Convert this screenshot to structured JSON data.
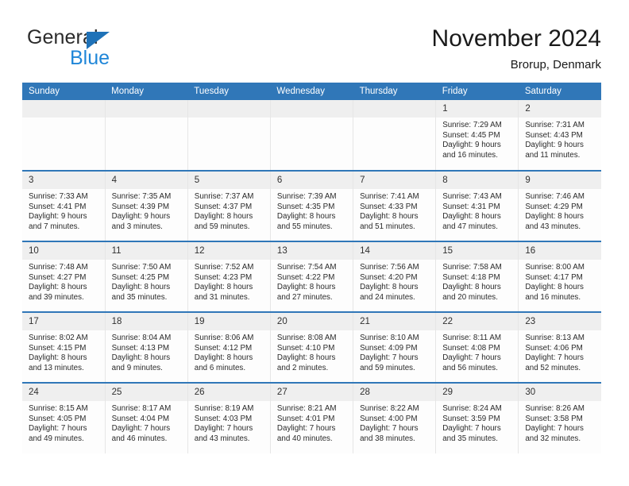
{
  "brand": {
    "name_part1": "General",
    "name_part2": "Blue",
    "logo_icon": "triangle-icon"
  },
  "header": {
    "title": "November 2024",
    "location": "Brorup, Denmark"
  },
  "colors": {
    "header_blue": "#3077b8",
    "brand_blue": "#1f86d8",
    "logo_triangle_blue": "#1f72b8",
    "daynum_band": "#efefef",
    "cell_background": "#fdfdfd",
    "divider": "#e6e6e6"
  },
  "weekday_headers": [
    "Sunday",
    "Monday",
    "Tuesday",
    "Wednesday",
    "Thursday",
    "Friday",
    "Saturday"
  ],
  "labels": {
    "sunrise_prefix": "Sunrise:",
    "sunset_prefix": "Sunset:",
    "daylight_prefix": "Daylight:"
  },
  "weeks": [
    [
      {
        "day": "",
        "sunrise": "",
        "sunset": "",
        "daylight_line1": "",
        "daylight_line2": "",
        "empty": true
      },
      {
        "day": "",
        "sunrise": "",
        "sunset": "",
        "daylight_line1": "",
        "daylight_line2": "",
        "empty": true
      },
      {
        "day": "",
        "sunrise": "",
        "sunset": "",
        "daylight_line1": "",
        "daylight_line2": "",
        "empty": true
      },
      {
        "day": "",
        "sunrise": "",
        "sunset": "",
        "daylight_line1": "",
        "daylight_line2": "",
        "empty": true
      },
      {
        "day": "",
        "sunrise": "",
        "sunset": "",
        "daylight_line1": "",
        "daylight_line2": "",
        "empty": true
      },
      {
        "day": "1",
        "sunrise": "Sunrise: 7:29 AM",
        "sunset": "Sunset: 4:45 PM",
        "daylight_line1": "Daylight: 9 hours",
        "daylight_line2": "and 16 minutes."
      },
      {
        "day": "2",
        "sunrise": "Sunrise: 7:31 AM",
        "sunset": "Sunset: 4:43 PM",
        "daylight_line1": "Daylight: 9 hours",
        "daylight_line2": "and 11 minutes."
      }
    ],
    [
      {
        "day": "3",
        "sunrise": "Sunrise: 7:33 AM",
        "sunset": "Sunset: 4:41 PM",
        "daylight_line1": "Daylight: 9 hours",
        "daylight_line2": "and 7 minutes."
      },
      {
        "day": "4",
        "sunrise": "Sunrise: 7:35 AM",
        "sunset": "Sunset: 4:39 PM",
        "daylight_line1": "Daylight: 9 hours",
        "daylight_line2": "and 3 minutes."
      },
      {
        "day": "5",
        "sunrise": "Sunrise: 7:37 AM",
        "sunset": "Sunset: 4:37 PM",
        "daylight_line1": "Daylight: 8 hours",
        "daylight_line2": "and 59 minutes."
      },
      {
        "day": "6",
        "sunrise": "Sunrise: 7:39 AM",
        "sunset": "Sunset: 4:35 PM",
        "daylight_line1": "Daylight: 8 hours",
        "daylight_line2": "and 55 minutes."
      },
      {
        "day": "7",
        "sunrise": "Sunrise: 7:41 AM",
        "sunset": "Sunset: 4:33 PM",
        "daylight_line1": "Daylight: 8 hours",
        "daylight_line2": "and 51 minutes."
      },
      {
        "day": "8",
        "sunrise": "Sunrise: 7:43 AM",
        "sunset": "Sunset: 4:31 PM",
        "daylight_line1": "Daylight: 8 hours",
        "daylight_line2": "and 47 minutes."
      },
      {
        "day": "9",
        "sunrise": "Sunrise: 7:46 AM",
        "sunset": "Sunset: 4:29 PM",
        "daylight_line1": "Daylight: 8 hours",
        "daylight_line2": "and 43 minutes."
      }
    ],
    [
      {
        "day": "10",
        "sunrise": "Sunrise: 7:48 AM",
        "sunset": "Sunset: 4:27 PM",
        "daylight_line1": "Daylight: 8 hours",
        "daylight_line2": "and 39 minutes."
      },
      {
        "day": "11",
        "sunrise": "Sunrise: 7:50 AM",
        "sunset": "Sunset: 4:25 PM",
        "daylight_line1": "Daylight: 8 hours",
        "daylight_line2": "and 35 minutes."
      },
      {
        "day": "12",
        "sunrise": "Sunrise: 7:52 AM",
        "sunset": "Sunset: 4:23 PM",
        "daylight_line1": "Daylight: 8 hours",
        "daylight_line2": "and 31 minutes."
      },
      {
        "day": "13",
        "sunrise": "Sunrise: 7:54 AM",
        "sunset": "Sunset: 4:22 PM",
        "daylight_line1": "Daylight: 8 hours",
        "daylight_line2": "and 27 minutes."
      },
      {
        "day": "14",
        "sunrise": "Sunrise: 7:56 AM",
        "sunset": "Sunset: 4:20 PM",
        "daylight_line1": "Daylight: 8 hours",
        "daylight_line2": "and 24 minutes."
      },
      {
        "day": "15",
        "sunrise": "Sunrise: 7:58 AM",
        "sunset": "Sunset: 4:18 PM",
        "daylight_line1": "Daylight: 8 hours",
        "daylight_line2": "and 20 minutes."
      },
      {
        "day": "16",
        "sunrise": "Sunrise: 8:00 AM",
        "sunset": "Sunset: 4:17 PM",
        "daylight_line1": "Daylight: 8 hours",
        "daylight_line2": "and 16 minutes."
      }
    ],
    [
      {
        "day": "17",
        "sunrise": "Sunrise: 8:02 AM",
        "sunset": "Sunset: 4:15 PM",
        "daylight_line1": "Daylight: 8 hours",
        "daylight_line2": "and 13 minutes."
      },
      {
        "day": "18",
        "sunrise": "Sunrise: 8:04 AM",
        "sunset": "Sunset: 4:13 PM",
        "daylight_line1": "Daylight: 8 hours",
        "daylight_line2": "and 9 minutes."
      },
      {
        "day": "19",
        "sunrise": "Sunrise: 8:06 AM",
        "sunset": "Sunset: 4:12 PM",
        "daylight_line1": "Daylight: 8 hours",
        "daylight_line2": "and 6 minutes."
      },
      {
        "day": "20",
        "sunrise": "Sunrise: 8:08 AM",
        "sunset": "Sunset: 4:10 PM",
        "daylight_line1": "Daylight: 8 hours",
        "daylight_line2": "and 2 minutes."
      },
      {
        "day": "21",
        "sunrise": "Sunrise: 8:10 AM",
        "sunset": "Sunset: 4:09 PM",
        "daylight_line1": "Daylight: 7 hours",
        "daylight_line2": "and 59 minutes."
      },
      {
        "day": "22",
        "sunrise": "Sunrise: 8:11 AM",
        "sunset": "Sunset: 4:08 PM",
        "daylight_line1": "Daylight: 7 hours",
        "daylight_line2": "and 56 minutes."
      },
      {
        "day": "23",
        "sunrise": "Sunrise: 8:13 AM",
        "sunset": "Sunset: 4:06 PM",
        "daylight_line1": "Daylight: 7 hours",
        "daylight_line2": "and 52 minutes."
      }
    ],
    [
      {
        "day": "24",
        "sunrise": "Sunrise: 8:15 AM",
        "sunset": "Sunset: 4:05 PM",
        "daylight_line1": "Daylight: 7 hours",
        "daylight_line2": "and 49 minutes."
      },
      {
        "day": "25",
        "sunrise": "Sunrise: 8:17 AM",
        "sunset": "Sunset: 4:04 PM",
        "daylight_line1": "Daylight: 7 hours",
        "daylight_line2": "and 46 minutes."
      },
      {
        "day": "26",
        "sunrise": "Sunrise: 8:19 AM",
        "sunset": "Sunset: 4:03 PM",
        "daylight_line1": "Daylight: 7 hours",
        "daylight_line2": "and 43 minutes."
      },
      {
        "day": "27",
        "sunrise": "Sunrise: 8:21 AM",
        "sunset": "Sunset: 4:01 PM",
        "daylight_line1": "Daylight: 7 hours",
        "daylight_line2": "and 40 minutes."
      },
      {
        "day": "28",
        "sunrise": "Sunrise: 8:22 AM",
        "sunset": "Sunset: 4:00 PM",
        "daylight_line1": "Daylight: 7 hours",
        "daylight_line2": "and 38 minutes."
      },
      {
        "day": "29",
        "sunrise": "Sunrise: 8:24 AM",
        "sunset": "Sunset: 3:59 PM",
        "daylight_line1": "Daylight: 7 hours",
        "daylight_line2": "and 35 minutes."
      },
      {
        "day": "30",
        "sunrise": "Sunrise: 8:26 AM",
        "sunset": "Sunset: 3:58 PM",
        "daylight_line1": "Daylight: 7 hours",
        "daylight_line2": "and 32 minutes."
      }
    ]
  ]
}
